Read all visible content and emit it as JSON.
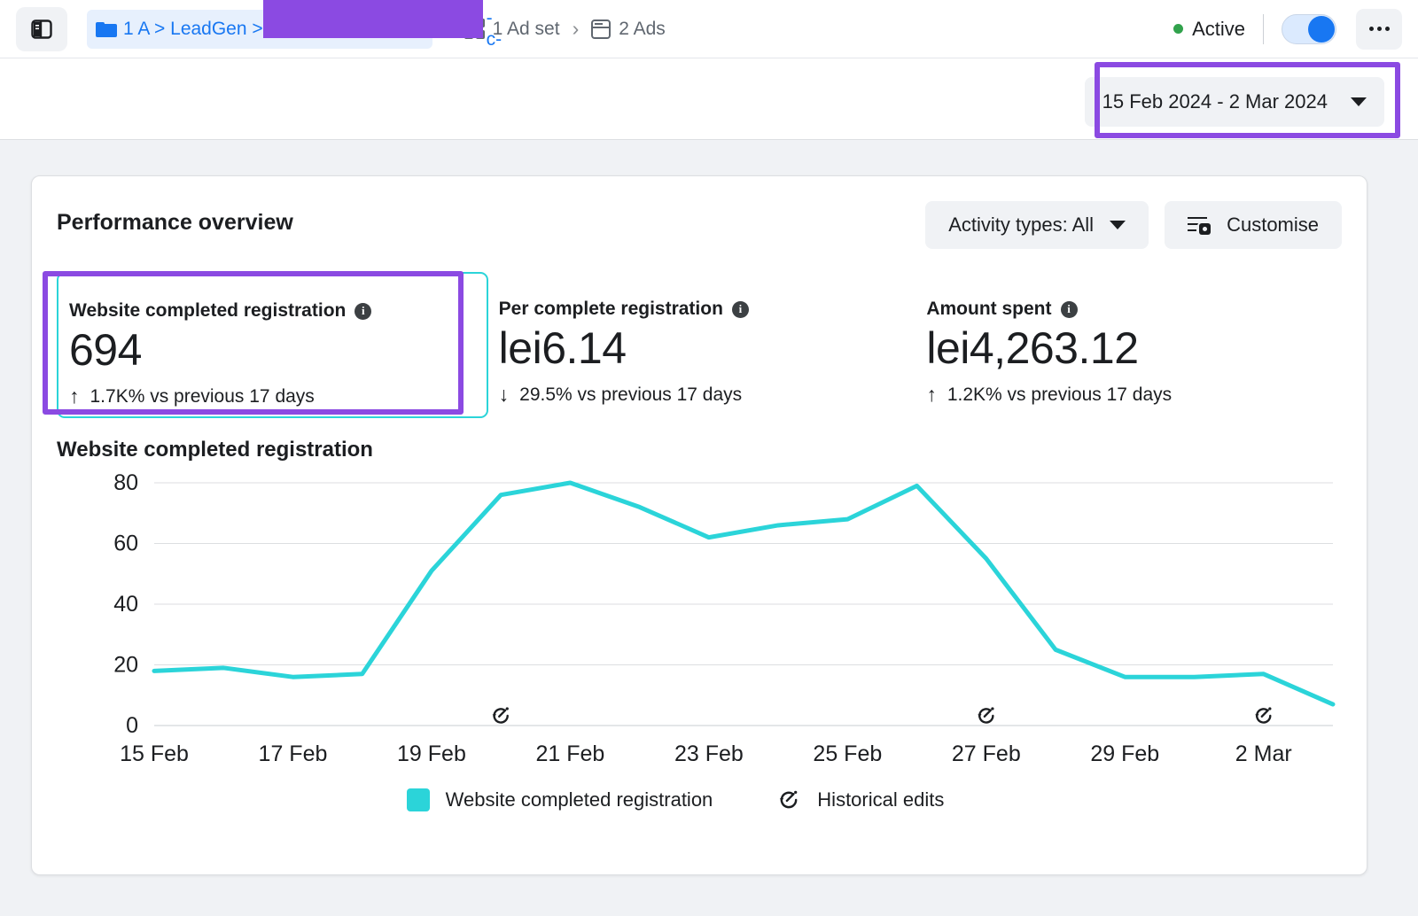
{
  "header": {
    "panel_toggle_icon": "sidebar-panel-icon",
    "breadcrumb": {
      "folder_icon": "folder-icon",
      "campaign_prefix": "1 A > LeadGen >",
      "campaign_redacted": "",
      "campaign_suffix": "-c-",
      "separator": "›",
      "items": [
        {
          "icon": "grid-icon",
          "label": "1 Ad set"
        },
        {
          "icon": "ads-icon",
          "label": "2 Ads"
        }
      ]
    },
    "status_label": "Active",
    "status_color": "#31a24c",
    "toggle_on": true,
    "more_icon": "more-options-icon"
  },
  "date_bar": {
    "range_label": "15 Feb 2024 - 2 Mar 2024",
    "caret_icon": "chevron-down-icon",
    "highlight_color": "#8b4ae2"
  },
  "panel": {
    "title": "Performance overview",
    "activity_types_label": "Activity types: All",
    "customise_label": "Customise"
  },
  "metrics": [
    {
      "label": "Website completed registration",
      "value": "694",
      "delta_arrow": "↑",
      "delta": "1.7K% vs previous 17 days",
      "selected": true
    },
    {
      "label": "Per complete registration",
      "value": "lei6.14",
      "delta_arrow": "↓",
      "delta": "29.5% vs previous 17 days",
      "selected": false
    },
    {
      "label": "Amount spent",
      "value": "lei4,263.12",
      "delta_arrow": "↑",
      "delta": "1.2K% vs previous 17 days",
      "selected": false
    }
  ],
  "chart_title": "Website completed registration",
  "legend": [
    {
      "type": "swatch",
      "label": "Website completed registration",
      "color": "#2bd4d9"
    },
    {
      "type": "edit-icon",
      "label": "Historical edits",
      "color": "#1c1e21"
    }
  ],
  "chart_data": {
    "type": "line",
    "title": "Website completed registration",
    "xlabel": "",
    "ylabel": "",
    "ylim": [
      0,
      80
    ],
    "yticks": [
      0,
      20,
      40,
      60,
      80
    ],
    "grid": true,
    "legend_position": "bottom",
    "line_color": "#2bd4d9",
    "x": [
      "15 Feb",
      "16 Feb",
      "17 Feb",
      "18 Feb",
      "19 Feb",
      "20 Feb",
      "21 Feb",
      "22 Feb",
      "23 Feb",
      "24 Feb",
      "25 Feb",
      "26 Feb",
      "27 Feb",
      "28 Feb",
      "29 Feb",
      "1 Mar",
      "2 Mar"
    ],
    "xtick_labels": [
      "15 Feb",
      "17 Feb",
      "19 Feb",
      "21 Feb",
      "23 Feb",
      "25 Feb",
      "27 Feb",
      "29 Feb",
      "2 Mar"
    ],
    "series": [
      {
        "name": "Website completed registration",
        "values": [
          18,
          19,
          16,
          17,
          51,
          76,
          80,
          72,
          62,
          66,
          68,
          79,
          55,
          25,
          16,
          16,
          17,
          7
        ]
      }
    ],
    "annotations": [
      {
        "type": "historical-edit",
        "x_label": "20 Feb",
        "icon": "historical-edit-icon"
      },
      {
        "type": "historical-edit",
        "x_label": "27 Feb",
        "icon": "historical-edit-icon"
      },
      {
        "type": "historical-edit",
        "x_label": "2 Mar",
        "icon": "historical-edit-icon"
      }
    ]
  }
}
